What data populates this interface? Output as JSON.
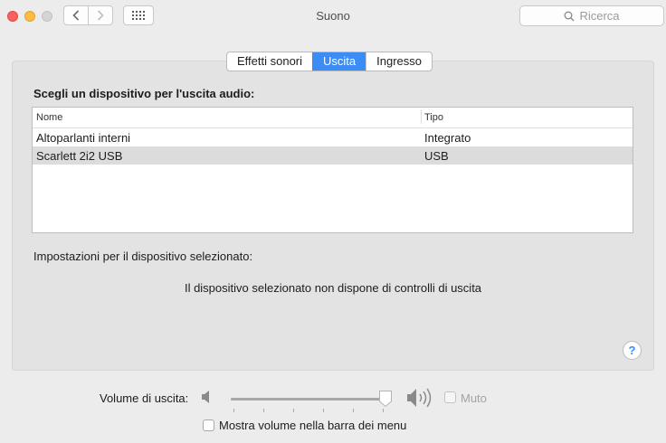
{
  "window": {
    "title": "Suono",
    "search_placeholder": "Ricerca"
  },
  "tabs": [
    {
      "label": "Effetti sonori",
      "active": false
    },
    {
      "label": "Uscita",
      "active": true
    },
    {
      "label": "Ingresso",
      "active": false
    }
  ],
  "output": {
    "section_title": "Scegli un dispositivo per l'uscita audio:",
    "columns": {
      "name": "Nome",
      "type": "Tipo"
    },
    "devices": [
      {
        "name": "Altoparlanti interni",
        "type": "Integrato",
        "selected": false
      },
      {
        "name": "Scarlett 2i2 USB",
        "type": "USB",
        "selected": true
      }
    ],
    "settings_label": "Impostazioni per il dispositivo selezionato:",
    "no_controls_message": "Il dispositivo selezionato non dispone di controlli di uscita"
  },
  "volume": {
    "label": "Volume di uscita:",
    "level": 0.97,
    "mute_label": "Muto",
    "mute_checked": false,
    "mute_enabled": false,
    "show_in_menu_label": "Mostra volume nella barra dei menu",
    "show_in_menu_checked": false
  },
  "help": {
    "glyph": "?"
  },
  "colors": {
    "accent": "#3b8cf5",
    "close": "#fc605c",
    "minimize": "#fdbc40",
    "zoom": "#d4d4d4"
  },
  "icons": {
    "back": "chevron-left-icon",
    "forward": "chevron-right-icon",
    "grid": "grid-icon",
    "search": "magnifier-icon",
    "volume_low": "speaker-low-icon",
    "volume_high": "speaker-high-icon"
  }
}
